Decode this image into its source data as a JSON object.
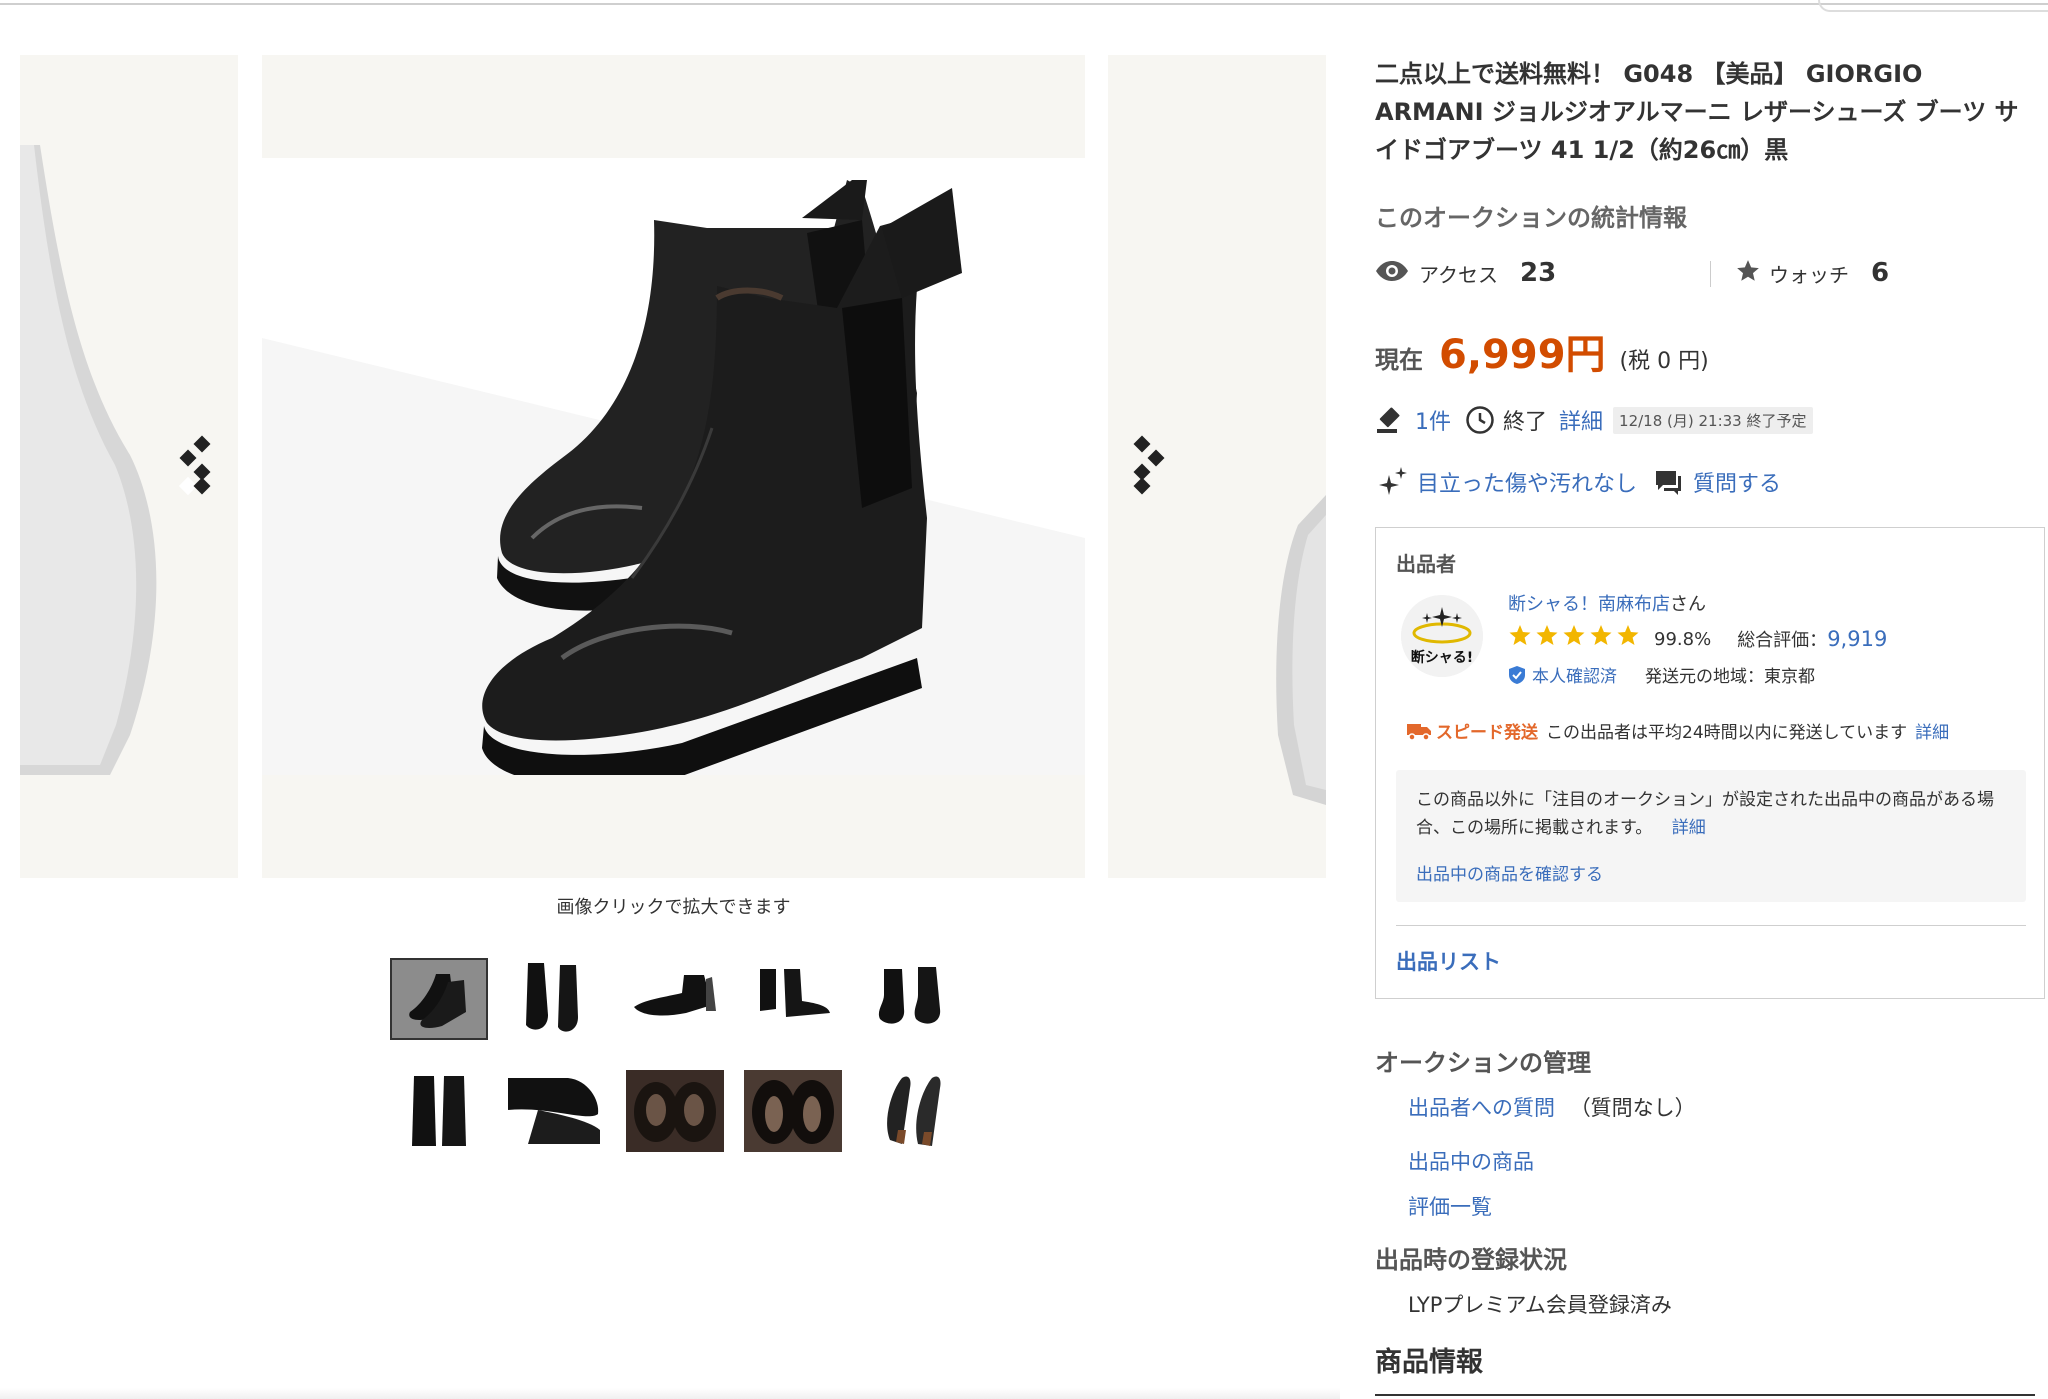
{
  "gallery": {
    "caption": "画像クリックで拡大できます",
    "thumb_count": 10,
    "selected_thumb": 1
  },
  "listing": {
    "title": "二点以上で送料無料！ G048 【美品】 GIORGIO ARMANI ジョルジオアルマーニ レザーシューズ ブーツ サイドゴアブーツ 41 1/2（約26㎝）黒",
    "stats_heading": "このオークションの統計情報",
    "access_label": "アクセス",
    "access_count": "23",
    "watch_label": "ウォッチ",
    "watch_count": "6",
    "price_label": "現在",
    "price": "6,999円",
    "tax": "(税 0 円)",
    "bids": "1件",
    "end_label": "終了",
    "detail_link": "詳細",
    "end_time": "12/18 (月) 21:33 終了予定",
    "condition": "目立った傷や汚れなし",
    "question_link": "質問する"
  },
  "seller": {
    "heading": "出品者",
    "avatar_text": "断シャる!",
    "name": "断シャる！南麻布店",
    "name_suffix": "さん",
    "rating_pct": "99.8%",
    "total_label": "総合評価：",
    "total_value": "9,919",
    "verified": "本人確認済",
    "region": "発送元の地域：東京都",
    "speed_label": "スピード発送",
    "speed_text": "この出品者は平均24時間以内に発送しています",
    "speed_detail": "詳細",
    "notice_text": "この商品以外に「注目のオークション」が設定された出品中の商品がある場合、この場所に掲載されます。",
    "notice_detail": "詳細",
    "notice_link": "出品中の商品を確認する",
    "list_link": "出品リスト",
    "rating_stars": 5
  },
  "management": {
    "heading": "オークションの管理",
    "question_link": "出品者への質問",
    "question_note": "（質問なし）",
    "items_link": "出品中の商品",
    "reviews_link": "評価一覧"
  },
  "registration": {
    "heading": "出品時の登録状況",
    "value": "LYPプレミアム会員登録済み"
  },
  "product_info": {
    "heading": "商品情報"
  },
  "colors": {
    "link": "#3a6dbb",
    "price": "#d24c00",
    "speed": "#e3682b",
    "star": "#f2b600"
  }
}
